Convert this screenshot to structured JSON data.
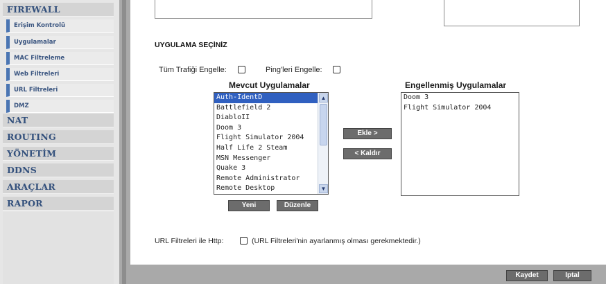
{
  "sidebar": {
    "items": [
      {
        "label": "FIREWALL",
        "type": "main"
      },
      {
        "label": "Erişim Kontrolü",
        "type": "sub"
      },
      {
        "label": "Uygulamalar",
        "type": "sub"
      },
      {
        "label": "MAC Filtreleme",
        "type": "sub"
      },
      {
        "label": "Web Filtreleri",
        "type": "sub"
      },
      {
        "label": "URL Filtreleri",
        "type": "sub"
      },
      {
        "label": "DMZ",
        "type": "sub"
      },
      {
        "label": "NAT",
        "type": "main"
      },
      {
        "label": "ROUTING",
        "type": "main"
      },
      {
        "label": "YÖNETİM",
        "type": "main"
      },
      {
        "label": "DDNS",
        "type": "main"
      },
      {
        "label": "ARAÇLAR",
        "type": "main"
      },
      {
        "label": "RAPOR",
        "type": "main"
      }
    ]
  },
  "main": {
    "section_title": "UYGULAMA SEÇİNİZ",
    "block_all_label": "Tüm Trafiği Engelle:",
    "block_ping_label": "Ping'leri Engelle:",
    "available": {
      "title": "Mevcut Uygulamalar",
      "selected": "Auth-IdentD",
      "items": [
        "Auth-IdentD",
        "Battlefield 2",
        "DiabloII",
        "Doom 3",
        "Flight Simulator 2004",
        "Half Life 2 Steam",
        "MSN Messenger",
        "Quake 3",
        "Remote Administrator",
        "Remote Desktop"
      ]
    },
    "blocked": {
      "title": "Engellenmiş Uygulamalar",
      "items": [
        "Doom 3",
        "Flight Simulator 2004"
      ]
    },
    "add_button": "Ekle >",
    "remove_button": "< Kaldır",
    "new_button": "Yeni",
    "edit_button": "Düzenle",
    "url_filter_label": "URL Filtreleri ile Http:",
    "url_filter_note": "(URL Filtreleri'nin ayarlanmış olması gerekmektedir.)"
  },
  "footer": {
    "save_button": "Kaydet",
    "cancel_button": "Iptal"
  },
  "colors": {
    "accent": "#4a75b3",
    "sidebar_text": "#33507c",
    "button": "#6c6c6c",
    "selection": "#3060c0"
  }
}
